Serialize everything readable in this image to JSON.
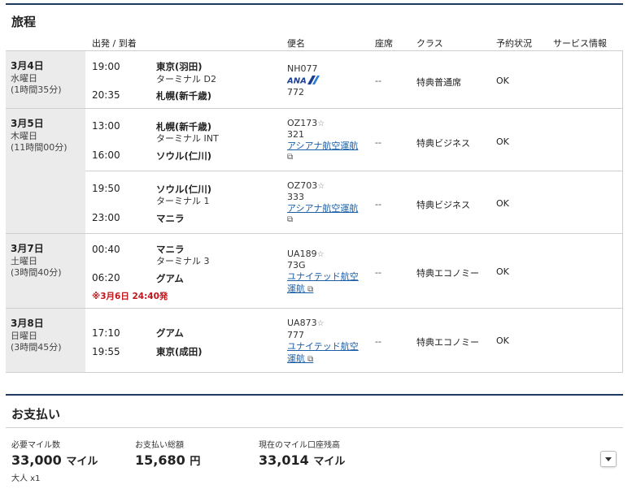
{
  "itinerary": {
    "title": "旅程",
    "headers": {
      "dep_arr": "出発 / 到着",
      "flight": "便名",
      "seat": "座席",
      "class": "クラス",
      "status": "予約状況",
      "service": "サービス情報"
    },
    "days": [
      {
        "date": "3月4日",
        "weekday": "水曜日",
        "duration": "(1時間35分)",
        "segments": [
          {
            "dep_time": "19:00",
            "dep_place": "東京(羽田)",
            "dep_terminal": "ターミナル D2",
            "arr_time": "20:35",
            "arr_place": "札幌(新千歳)",
            "flight": "NH077",
            "airline_logo": "ANA",
            "aircraft": "772",
            "seat": "--",
            "class": "特典普通席",
            "status": "OK"
          }
        ]
      },
      {
        "date": "3月5日",
        "weekday": "木曜日",
        "duration": "(11時間00分)",
        "segments": [
          {
            "dep_time": "13:00",
            "dep_place": "札幌(新千歳)",
            "dep_terminal": "ターミナル INT",
            "arr_time": "16:00",
            "arr_place": "ソウル(仁川)",
            "flight": "OZ173",
            "aircraft": "321",
            "operator": "アシアナ航空運航",
            "seat": "--",
            "class": "特典ビジネス",
            "status": "OK"
          },
          {
            "dep_time": "19:50",
            "dep_place": "ソウル(仁川)",
            "dep_terminal": "ターミナル 1",
            "arr_time": "23:00",
            "arr_place": "マニラ",
            "flight": "OZ703",
            "aircraft": "333",
            "operator": "アシアナ航空運航",
            "seat": "--",
            "class": "特典ビジネス",
            "status": "OK"
          }
        ]
      },
      {
        "date": "3月7日",
        "weekday": "土曜日",
        "duration": "(3時間40分)",
        "segments": [
          {
            "dep_time": "00:40",
            "dep_place": "マニラ",
            "dep_terminal": "ターミナル 3",
            "arr_time": "06:20",
            "arr_place": "グアム",
            "note": "※3月6日 24:40発",
            "flight": "UA189",
            "aircraft": "73G",
            "operator_line1": "ユナイテッド航空",
            "operator_line2": "運航",
            "seat": "--",
            "class": "特典エコノミー",
            "status": "OK"
          }
        ]
      },
      {
        "date": "3月8日",
        "weekday": "日曜日",
        "duration": "(3時間45分)",
        "segments": [
          {
            "dep_time": "17:10",
            "dep_place": "グアム",
            "arr_time": "19:55",
            "arr_place": "東京(成田)",
            "flight": "UA873",
            "aircraft": "777",
            "operator_line1": "ユナイテッド航空",
            "operator_line2": "運航",
            "seat": "--",
            "class": "特典エコノミー",
            "status": "OK"
          }
        ]
      }
    ]
  },
  "payment": {
    "title": "お支払い",
    "miles_label": "必要マイル数",
    "miles_value": "33,000",
    "miles_unit": "マイル",
    "passengers": "大人 x1",
    "total_label": "お支払い総額",
    "total_value": "15,680",
    "total_unit": "円",
    "balance_label": "現在のマイル口座残高",
    "balance_value": "33,014",
    "balance_unit": "マイル"
  },
  "colors": {
    "accent": "#1f3a5f",
    "link": "#1a5fa8",
    "warning": "#c0161b",
    "date_bg": "#ebebeb"
  }
}
